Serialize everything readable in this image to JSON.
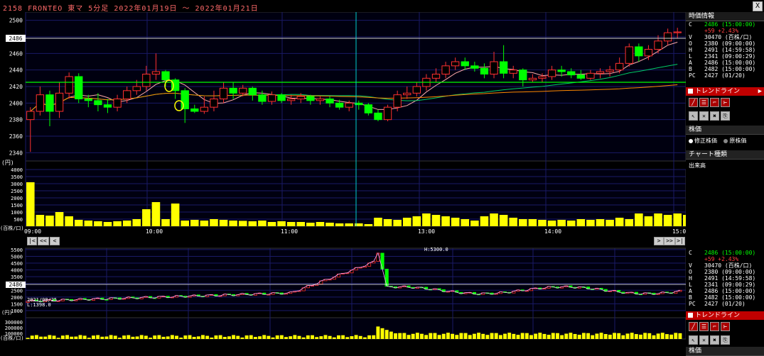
{
  "window": {
    "title": "2158 FRONTEO 東マ 5分足 2022年01月19日 ～ 2022年01月21日",
    "close_label": "X"
  },
  "main_chart": {
    "price_axis": [
      "2500",
      "2480",
      "2460",
      "2440",
      "2420",
      "2400",
      "2380",
      "2360",
      "2340"
    ],
    "price_unit": "(円)",
    "current_price_tag": "2486",
    "volume_axis": [
      "4000",
      "3500",
      "3000",
      "2500",
      "2000",
      "1500",
      "1000",
      "500"
    ],
    "volume_unit": "(百株/口)",
    "time_labels": [
      "09:00",
      "10:00",
      "11:00",
      "13:00",
      "14:00",
      "15:00"
    ]
  },
  "nav": {
    "first": "|<",
    "prev_page": "<<",
    "prev": "<",
    "next": ">",
    "next_page": ">>",
    "last": ">|"
  },
  "info_panel": {
    "header": "時価情報",
    "rows": [
      {
        "k": "C",
        "v": "2486 (15:00:00)",
        "color": "#00ff00"
      },
      {
        "k": "",
        "v": "+59 +2.43%",
        "color": "#ff4040"
      },
      {
        "k": "V",
        "v": "30470 (百株/口)",
        "color": "#ffffff"
      },
      {
        "k": "O",
        "v": "2380 (09:00:00)",
        "color": "#ffffff"
      },
      {
        "k": "H",
        "v": "2491 (14:59:58)",
        "color": "#ffffff"
      },
      {
        "k": "L",
        "v": "2341 (09:00:29)",
        "color": "#ffffff"
      },
      {
        "k": "A",
        "v": "2486 (15:00:00)",
        "color": "#ffffff"
      },
      {
        "k": "B",
        "v": "2482 (15:00:00)",
        "color": "#ffffff"
      },
      {
        "k": "PC",
        "v": "2427 (01/20)",
        "color": "#ffffff"
      }
    ]
  },
  "trendline": {
    "label": "トレンドライン",
    "arrow": "▶"
  },
  "kabuka": {
    "header": "株価",
    "option1": "修正株価",
    "option2": "原株価"
  },
  "chart_type": {
    "header": "チャート種類",
    "value": "出来高"
  },
  "lower_chart": {
    "price_axis": [
      "5500",
      "5000",
      "4500",
      "4000",
      "3500",
      "3000",
      "2500",
      "2000",
      "1500",
      "1000"
    ],
    "current_price_tag": "2486",
    "high_note": "H:5300.0",
    "low_date": "2021/08/25",
    "low_note": "L:1398.0",
    "price_unit": "(円)",
    "volume_axis": [
      "300000",
      "200000",
      "100000"
    ],
    "volume_unit": "(百株/口)"
  },
  "lower_info": {
    "rows": [
      {
        "k": "C",
        "v": "2486 (15:00:00)",
        "color": "#00ff00"
      },
      {
        "k": "",
        "v": "+59 +2.43%",
        "color": "#ff4040"
      },
      {
        "k": "V",
        "v": "30470 (百株/口)",
        "color": "#ffffff"
      },
      {
        "k": "O",
        "v": "2380 (09:00:00)",
        "color": "#ffffff"
      },
      {
        "k": "H",
        "v": "2491 (14:59:58)",
        "color": "#ffffff"
      },
      {
        "k": "L",
        "v": "2341 (09:00:29)",
        "color": "#ffffff"
      },
      {
        "k": "A",
        "v": "2486 (15:00:00)",
        "color": "#ffffff"
      },
      {
        "k": "B",
        "v": "2482 (15:00:00)",
        "color": "#ffffff"
      },
      {
        "k": "PC",
        "v": "2427 (01/20)",
        "color": "#ffffff"
      }
    ],
    "trendline_label": "トレンドライン",
    "bottom_label": "株価"
  },
  "chart_data": [
    {
      "type": "candlestick",
      "ylim": [
        2330,
        2510
      ],
      "candles": [
        {
          "o": 2380,
          "c": 2390,
          "h": 2395,
          "l": 2341
        },
        {
          "o": 2390,
          "c": 2410,
          "h": 2420,
          "l": 2385
        },
        {
          "o": 2410,
          "c": 2390,
          "h": 2415,
          "l": 2372
        },
        {
          "o": 2390,
          "c": 2412,
          "h": 2425,
          "l": 2382
        },
        {
          "o": 2412,
          "c": 2432,
          "h": 2437,
          "l": 2405
        },
        {
          "o": 2432,
          "c": 2405,
          "h": 2436,
          "l": 2400
        },
        {
          "o": 2405,
          "c": 2403,
          "h": 2410,
          "l": 2395
        },
        {
          "o": 2403,
          "c": 2398,
          "h": 2412,
          "l": 2390
        },
        {
          "o": 2398,
          "c": 2395,
          "h": 2405,
          "l": 2388
        },
        {
          "o": 2395,
          "c": 2405,
          "h": 2410,
          "l": 2390
        },
        {
          "o": 2405,
          "c": 2415,
          "h": 2420,
          "l": 2400
        },
        {
          "o": 2415,
          "c": 2420,
          "h": 2428,
          "l": 2410
        },
        {
          "o": 2420,
          "c": 2435,
          "h": 2445,
          "l": 2415
        },
        {
          "o": 2435,
          "c": 2438,
          "h": 2460,
          "l": 2428
        },
        {
          "o": 2438,
          "c": 2428,
          "h": 2440,
          "l": 2420
        },
        {
          "o": 2428,
          "c": 2415,
          "h": 2430,
          "l": 2405
        },
        {
          "o": 2415,
          "c": 2393,
          "h": 2418,
          "l": 2376
        },
        {
          "o": 2393,
          "c": 2390,
          "h": 2398,
          "l": 2388
        },
        {
          "o": 2390,
          "c": 2395,
          "h": 2408,
          "l": 2387
        },
        {
          "o": 2395,
          "c": 2405,
          "h": 2415,
          "l": 2390
        },
        {
          "o": 2405,
          "c": 2418,
          "h": 2425,
          "l": 2400
        },
        {
          "o": 2418,
          "c": 2412,
          "h": 2425,
          "l": 2405
        },
        {
          "o": 2412,
          "c": 2418,
          "h": 2422,
          "l": 2408
        },
        {
          "o": 2418,
          "c": 2410,
          "h": 2420,
          "l": 2403
        },
        {
          "o": 2410,
          "c": 2402,
          "h": 2415,
          "l": 2398
        },
        {
          "o": 2402,
          "c": 2410,
          "h": 2414,
          "l": 2398
        },
        {
          "o": 2410,
          "c": 2403,
          "h": 2412,
          "l": 2400
        },
        {
          "o": 2403,
          "c": 2405,
          "h": 2410,
          "l": 2398
        },
        {
          "o": 2405,
          "c": 2408,
          "h": 2412,
          "l": 2400
        },
        {
          "o": 2408,
          "c": 2403,
          "h": 2410,
          "l": 2398
        },
        {
          "o": 2403,
          "c": 2405,
          "h": 2408,
          "l": 2398
        },
        {
          "o": 2405,
          "c": 2400,
          "h": 2408,
          "l": 2395
        },
        {
          "o": 2400,
          "c": 2395,
          "h": 2404,
          "l": 2392
        },
        {
          "o": 2395,
          "c": 2400,
          "h": 2403,
          "l": 2390
        },
        {
          "o": 2400,
          "c": 2398,
          "h": 2403,
          "l": 2392
        },
        {
          "o": 2398,
          "c": 2388,
          "h": 2400,
          "l": 2385
        },
        {
          "o": 2388,
          "c": 2380,
          "h": 2392,
          "l": 2378
        },
        {
          "o": 2380,
          "c": 2395,
          "h": 2398,
          "l": 2378
        },
        {
          "o": 2395,
          "c": 2410,
          "h": 2415,
          "l": 2390
        },
        {
          "o": 2410,
          "c": 2412,
          "h": 2420,
          "l": 2405
        },
        {
          "o": 2412,
          "c": 2420,
          "h": 2425,
          "l": 2408
        },
        {
          "o": 2420,
          "c": 2430,
          "h": 2435,
          "l": 2415
        },
        {
          "o": 2430,
          "c": 2435,
          "h": 2442,
          "l": 2425
        },
        {
          "o": 2435,
          "c": 2445,
          "h": 2450,
          "l": 2430
        },
        {
          "o": 2445,
          "c": 2450,
          "h": 2455,
          "l": 2440
        },
        {
          "o": 2450,
          "c": 2445,
          "h": 2455,
          "l": 2440
        },
        {
          "o": 2445,
          "c": 2442,
          "h": 2450,
          "l": 2438
        },
        {
          "o": 2442,
          "c": 2435,
          "h": 2448,
          "l": 2430
        },
        {
          "o": 2435,
          "c": 2450,
          "h": 2462,
          "l": 2430
        },
        {
          "o": 2450,
          "c": 2436,
          "h": 2470,
          "l": 2430
        },
        {
          "o": 2436,
          "c": 2440,
          "h": 2445,
          "l": 2430
        },
        {
          "o": 2440,
          "c": 2428,
          "h": 2442,
          "l": 2420
        },
        {
          "o": 2428,
          "c": 2430,
          "h": 2435,
          "l": 2425
        },
        {
          "o": 2430,
          "c": 2432,
          "h": 2436,
          "l": 2425
        },
        {
          "o": 2432,
          "c": 2440,
          "h": 2445,
          "l": 2428
        },
        {
          "o": 2440,
          "c": 2438,
          "h": 2445,
          "l": 2432
        },
        {
          "o": 2438,
          "c": 2434,
          "h": 2442,
          "l": 2430
        },
        {
          "o": 2434,
          "c": 2430,
          "h": 2440,
          "l": 2428
        },
        {
          "o": 2430,
          "c": 2436,
          "h": 2440,
          "l": 2428
        },
        {
          "o": 2436,
          "c": 2438,
          "h": 2442,
          "l": 2430
        },
        {
          "o": 2438,
          "c": 2440,
          "h": 2445,
          "l": 2432
        },
        {
          "o": 2440,
          "c": 2448,
          "h": 2455,
          "l": 2436
        },
        {
          "o": 2448,
          "c": 2468,
          "h": 2472,
          "l": 2444
        },
        {
          "o": 2468,
          "c": 2457,
          "h": 2472,
          "l": 2450
        },
        {
          "o": 2457,
          "c": 2465,
          "h": 2470,
          "l": 2452
        },
        {
          "o": 2465,
          "c": 2475,
          "h": 2482,
          "l": 2460
        },
        {
          "o": 2475,
          "c": 2485,
          "h": 2490,
          "l": 2470
        },
        {
          "o": 2485,
          "c": 2486,
          "h": 2491,
          "l": 2478
        }
      ],
      "volume_unit": "百株/口",
      "volumes": [
        3100,
        800,
        750,
        1000,
        700,
        450,
        400,
        350,
        300,
        350,
        400,
        500,
        1200,
        1700,
        500,
        1600,
        400,
        450,
        400,
        500,
        450,
        400,
        380,
        350,
        400,
        300,
        350,
        300,
        300,
        250,
        300,
        250,
        200,
        200,
        200,
        150,
        600,
        500,
        450,
        600,
        700,
        900,
        800,
        700,
        600,
        500,
        400,
        700,
        900,
        800,
        600,
        500,
        500,
        450,
        400,
        450,
        400,
        500,
        450,
        500,
        450,
        600,
        500,
        900,
        700,
        900,
        800,
        900,
        800
      ]
    },
    {
      "type": "candlestick",
      "ylim": [
        1000,
        5600
      ],
      "high": 5300.0,
      "low": 1398.0
    }
  ]
}
